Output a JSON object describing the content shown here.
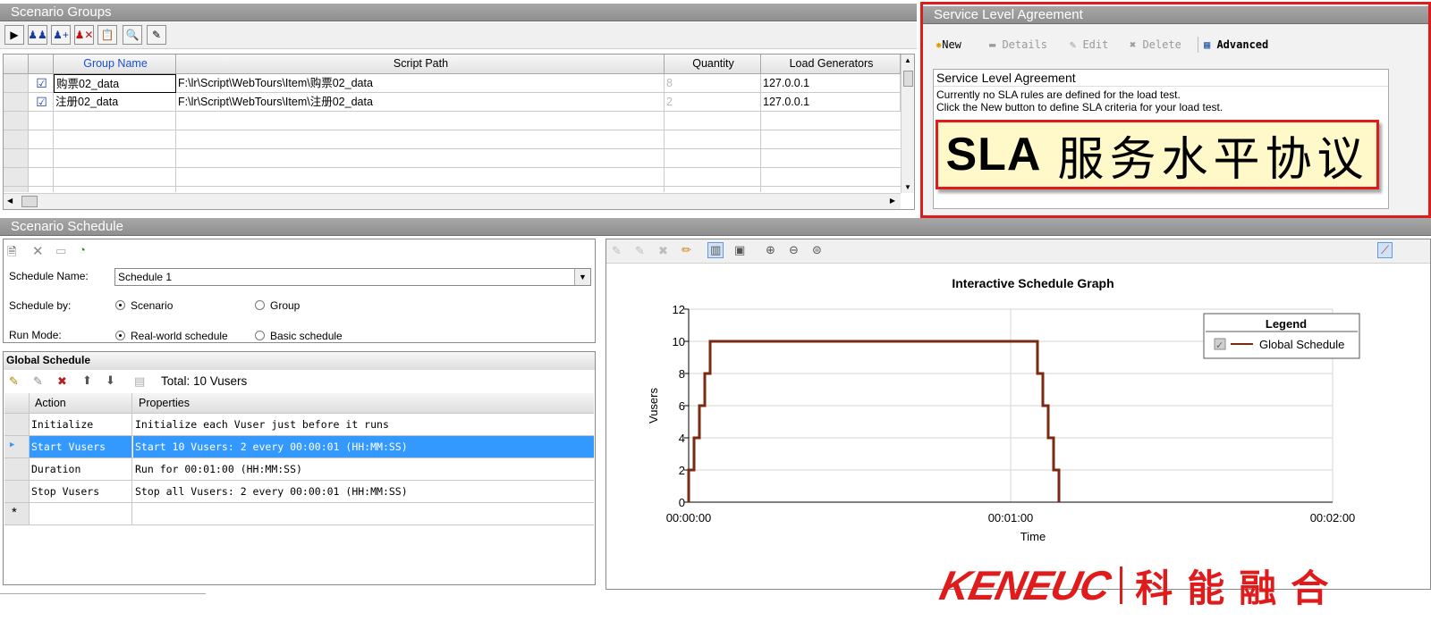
{
  "scenario_groups": {
    "title": "Scenario Groups",
    "columns": [
      "Group Name",
      "Script Path",
      "Quantity",
      "Load Generators"
    ],
    "rows": [
      {
        "checked": true,
        "name": "购票02_data",
        "path": "F:\\lr\\Script\\WebTours\\Item\\购票02_data",
        "quantity": "8",
        "lg": "127.0.0.1"
      },
      {
        "checked": true,
        "name": "注册02_data",
        "path": "F:\\lr\\Script\\WebTours\\Item\\注册02_data",
        "quantity": "2",
        "lg": "127.0.0.1"
      }
    ],
    "toolbar_icons": [
      "play-icon",
      "vusers-icon",
      "add-vusers-icon",
      "remove-vusers-icon",
      "clipboard-icon",
      "details-icon",
      "edit-icon"
    ]
  },
  "sla": {
    "title": "Service Level Agreement",
    "toolbar": {
      "new": "New",
      "details": "Details",
      "edit": "Edit",
      "delete": "Delete",
      "advanced": "Advanced"
    },
    "box_title": "Service Level Agreement",
    "line1": "Currently no SLA rules are defined for the load test.",
    "line2": "Click the New button to define SLA criteria for your load test.",
    "banner_en": "SLA",
    "banner_cn": "服务水平协议"
  },
  "schedule": {
    "title": "Scenario Schedule",
    "name_label": "Schedule Name:",
    "name_value": "Schedule 1",
    "by_label": "Schedule by:",
    "by_options": [
      "Scenario",
      "Group"
    ],
    "mode_label": "Run Mode:",
    "mode_options": [
      "Real-world schedule",
      "Basic schedule"
    ],
    "global_title": "Global Schedule",
    "total": "Total: 10 Vusers",
    "columns": [
      "Action",
      "Properties"
    ],
    "rows": [
      {
        "action": "Initialize",
        "props": "Initialize each Vuser just before it runs"
      },
      {
        "action": "Start  Vusers",
        "props": "Start 10 Vusers: 2 every 00:00:01 (HH:MM:SS)"
      },
      {
        "action": "Duration",
        "props": "Run for 00:01:00 (HH:MM:SS)"
      },
      {
        "action": "Stop Vusers",
        "props": "Stop all Vusers: 2 every 00:00:01 (HH:MM:SS)"
      }
    ],
    "new_row_marker": "*"
  },
  "chart_data": {
    "type": "line",
    "title": "Interactive Schedule Graph",
    "xlabel": "Time",
    "ylabel": "Vusers",
    "xticks": [
      "00:00:00",
      "00:01:00",
      "00:02:00"
    ],
    "yticks": [
      "0",
      "2",
      "4",
      "6",
      "8",
      "10",
      "12"
    ],
    "xlim_seconds": [
      0,
      120
    ],
    "ylim": [
      0,
      12
    ],
    "legend_title": "Legend",
    "legend_position": "top-right",
    "series": [
      {
        "name": "Global Schedule",
        "color": "#7a2a10",
        "x": [
          0,
          0,
          1,
          1,
          2,
          2,
          3,
          3,
          4,
          4,
          5,
          65,
          65,
          66,
          66,
          67,
          67,
          68,
          68,
          69,
          69
        ],
        "y": [
          0,
          2,
          2,
          4,
          4,
          6,
          6,
          8,
          8,
          10,
          10,
          10,
          8,
          8,
          6,
          6,
          4,
          4,
          2,
          2,
          0
        ]
      }
    ]
  },
  "watermark": {
    "latin": "KENEUC",
    "cn": "科能融合"
  }
}
